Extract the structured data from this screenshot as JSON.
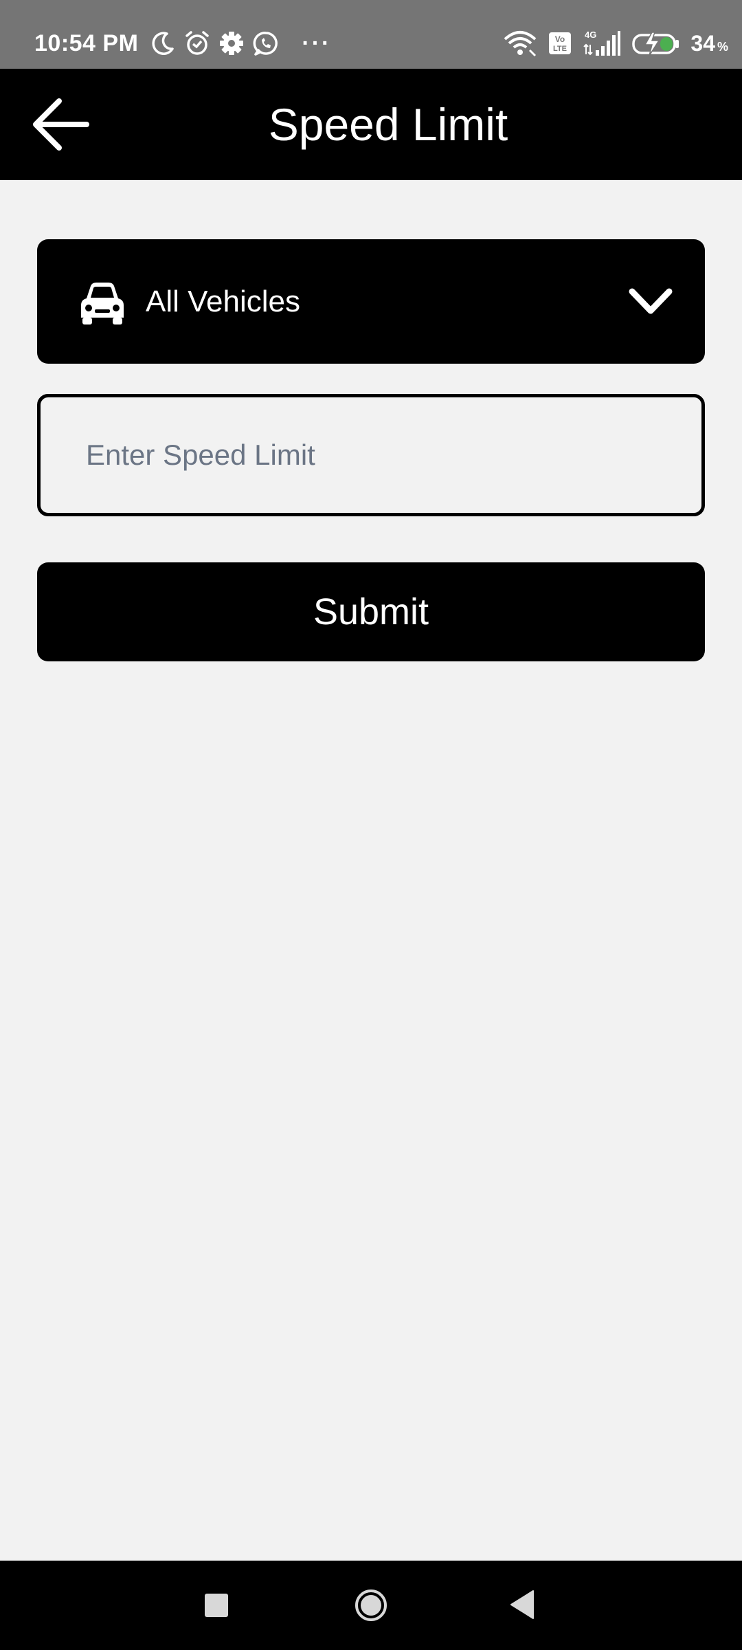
{
  "status_bar": {
    "time": "10:54 PM",
    "left_icons": [
      "moon-icon",
      "alarm-icon",
      "gear-icon",
      "whatsapp-icon"
    ],
    "more": "···",
    "network_type": "4G",
    "volte": "Vo LTE",
    "battery_percent": "34",
    "battery_unit": "%"
  },
  "header": {
    "title": "Speed Limit",
    "back_icon": "arrow-left-icon"
  },
  "vehicle_select": {
    "icon": "car-icon",
    "selected": "All Vehicles",
    "chevron": "chevron-down-icon"
  },
  "speed_input": {
    "placeholder": "Enter Speed Limit",
    "value": ""
  },
  "submit_label": "Submit",
  "nav": {
    "recents": "recents-icon",
    "home": "home-icon",
    "back": "back-triangle-icon"
  },
  "colors": {
    "app_bar": "#000000",
    "status_bar": "#757575",
    "background": "#f2f2f2",
    "placeholder": "#6b7585",
    "battery_accent": "#4caf50"
  }
}
